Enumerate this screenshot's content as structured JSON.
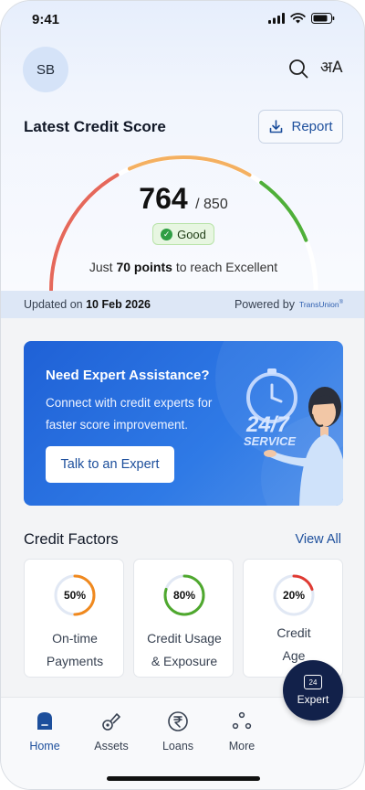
{
  "status_bar": {
    "time": "9:41"
  },
  "header": {
    "avatar_initials": "SB",
    "search_icon": "search-icon",
    "language_icon": "language-icon",
    "language_glyph": "अA"
  },
  "credit_score": {
    "title": "Latest Credit Score",
    "report_label": "Report",
    "score": "764",
    "max": "/ 850",
    "score_value": 764,
    "score_max_value": 850,
    "rating": "Good",
    "reach_prefix": "Just ",
    "reach_points": "70 points",
    "reach_suffix": " to reach Excellent",
    "updated_prefix": "Updated on ",
    "updated_date": "10 Feb 2026",
    "powered_by": "Powered by",
    "bureau_logo": "TransUnion",
    "gauge_colors": [
      "#e5685b",
      "#f4b061",
      "#4faf3a"
    ]
  },
  "banner": {
    "title": "Need Expert Assistance?",
    "subtitle": "Connect with credit experts for faster score improvement.",
    "button": "Talk to an Expert",
    "art_text_1": "24/7",
    "art_text_2": "SERVICE"
  },
  "credit_factors": {
    "title": "Credit Factors",
    "view_all": "View All",
    "items": [
      {
        "pct": "50%",
        "value": 50,
        "label_1": "On-time",
        "label_2": "Payments",
        "color": "#f0891e"
      },
      {
        "pct": "80%",
        "value": 80,
        "label_1": "Credit Usage",
        "label_2": "& Exposure",
        "color": "#4fa82e"
      },
      {
        "pct": "20%",
        "value": 20,
        "label_1": "Credit",
        "label_2": "Age",
        "color": "#e03a32"
      }
    ]
  },
  "expert_fab": {
    "label": "Expert",
    "badge": "24"
  },
  "bottom_nav": {
    "items": [
      {
        "label": "Home",
        "active": true
      },
      {
        "label": "Assets",
        "active": false
      },
      {
        "label": "Loans",
        "active": false
      },
      {
        "label": "More",
        "active": false
      }
    ]
  },
  "accent_color": "#1d4f9c"
}
